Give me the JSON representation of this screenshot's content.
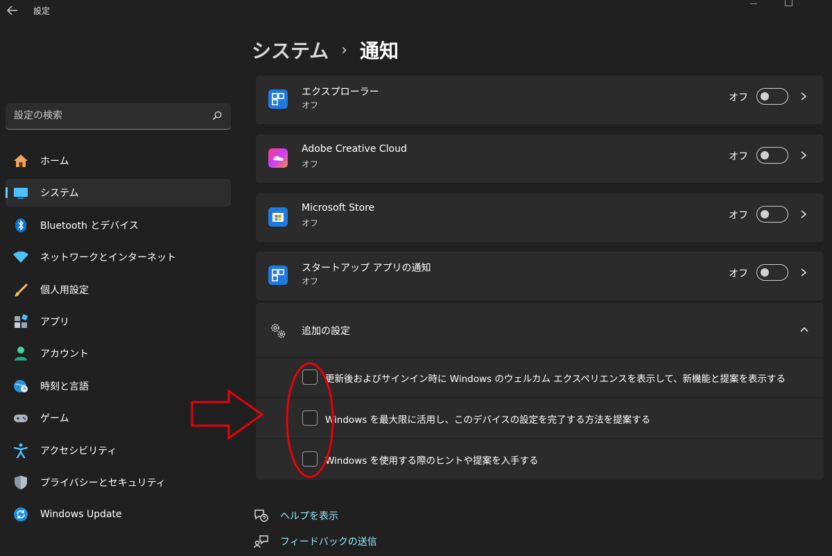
{
  "window": {
    "title": "設定"
  },
  "search": {
    "placeholder": "設定の検索"
  },
  "sidebar": {
    "items": [
      {
        "label": "ホーム",
        "icon": "home-icon"
      },
      {
        "label": "システム",
        "icon": "system-icon",
        "active": true
      },
      {
        "label": "Bluetooth とデバイス",
        "icon": "bluetooth-icon"
      },
      {
        "label": "ネットワークとインターネット",
        "icon": "wifi-icon"
      },
      {
        "label": "個人用設定",
        "icon": "brush-icon"
      },
      {
        "label": "アプリ",
        "icon": "apps-icon"
      },
      {
        "label": "アカウント",
        "icon": "account-icon"
      },
      {
        "label": "時刻と言語",
        "icon": "globe-clock-icon"
      },
      {
        "label": "ゲーム",
        "icon": "gamepad-icon"
      },
      {
        "label": "アクセシビリティ",
        "icon": "accessibility-icon"
      },
      {
        "label": "プライバシーとセキュリティ",
        "icon": "shield-icon"
      },
      {
        "label": "Windows Update",
        "icon": "windows-update-icon"
      }
    ]
  },
  "breadcrumb": {
    "parent": "システム",
    "separator": "›",
    "current": "通知"
  },
  "apps": [
    {
      "name": "エクスプローラー",
      "status": "オフ",
      "toggle_label": "オフ",
      "icon": "explorer-icon"
    },
    {
      "name": "Adobe Creative Cloud",
      "status": "オフ",
      "toggle_label": "オフ",
      "icon": "adobe-cc-icon"
    },
    {
      "name": "Microsoft Store",
      "status": "オフ",
      "toggle_label": "オフ",
      "icon": "store-icon"
    },
    {
      "name": "スタートアップ アプリの通知",
      "status": "オフ",
      "toggle_label": "オフ",
      "icon": "startup-icon"
    }
  ],
  "extra": {
    "title": "追加の設定",
    "options": [
      {
        "label": "更新後およびサインイン時に Windows のウェルカム エクスペリエンスを表示して、新機能と提案を表示する",
        "checked": false
      },
      {
        "label": "Windows を最大限に活用し、このデバイスの設定を完了する方法を提案する",
        "checked": false
      },
      {
        "label": "Windows を使用する際のヒントや提案を入手する",
        "checked": false
      }
    ]
  },
  "links": {
    "help": "ヘルプを表示",
    "feedback": "フィードバックの送信"
  },
  "colors": {
    "accent": "#60cdff",
    "annotation": "#e8000b"
  }
}
